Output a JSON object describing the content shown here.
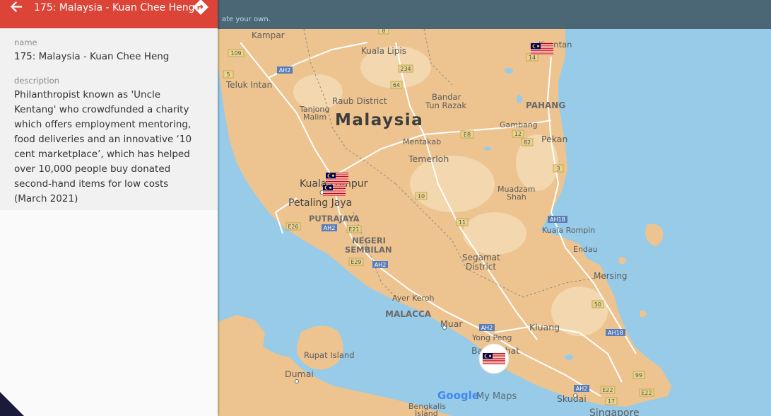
{
  "topbar": {
    "hint_text": "ate your own."
  },
  "panel": {
    "title": "175: Malaysia - Kuan Chee Heng",
    "fields": {
      "name_label": "name",
      "name_value": "175: Malaysia - Kuan Chee Heng",
      "description_label": "description",
      "description_value": "Philanthropist known as 'Uncle Kentang' who crowdfunded a charity which offers employment mentoring, food deliveries and an innovative ‘10 cent marketplace’, which has helped over 10,000 people buy donated second-hand items for low costs (March 2021)"
    }
  },
  "map": {
    "country_label": "Malaysia",
    "attribution": {
      "google": "Google",
      "mymaps": "My Maps"
    },
    "places": {
      "kampar": "Kampar",
      "kuala_lipis": "Kuala Lipis",
      "teluk_intan": "Teluk Intan",
      "raub_district": "Raub District",
      "bandar": "Bandar",
      "tun_razak": "Tun Razak",
      "tanjong": "Tanjong",
      "malim": "Malim",
      "pahang": "PAHANG",
      "kuantan": "Kuantan",
      "gambang": "Gambang",
      "pekan": "Pekan",
      "mentakab": "Mentakab",
      "temerloh": "Temerloh",
      "kuala_lumpur": "Kuala Lumpur",
      "petaling_jaya": "Petaling Jaya",
      "putrajaya": "PUTRAJAYA",
      "negeri": "NEGERI",
      "sembilan": "SEMBILAN",
      "muadzam": "Muadzam",
      "shah": "Shah",
      "kuala_rompin": "Kuala Rompin",
      "endau": "Endau",
      "segamat": "Segamat",
      "district": "District",
      "mersing": "Mersing",
      "ayer_keroh": "Ayer Keroh",
      "malacca": "MALACCA",
      "muar": "Muar",
      "kluang": "Kluang",
      "yong_peng": "Yong Peng",
      "batu_pahat": "Batu Pahat",
      "rupat_island": "Rupat Island",
      "dumai": "Dumai",
      "bengkalis": "Bengkalis",
      "island": "Island",
      "skudai": "Skudai",
      "singapore": "Singapore"
    },
    "road_shields": {
      "r109": "109",
      "r8": "8",
      "r5": "5",
      "ah2a": "AH2",
      "r234": "234",
      "r64": "64",
      "e8": "E8",
      "r12": "12",
      "r82": "82",
      "r14": "14",
      "r3": "3",
      "r10": "10",
      "r11": "11",
      "e26": "E26",
      "ah2b": "AH2",
      "e21": "E21",
      "e29": "E29",
      "ah2c": "AH2",
      "ah18a": "AH18",
      "ah2d": "AH2",
      "r50": "50",
      "ah18b": "AH18",
      "r99": "99",
      "ah2e": "AH2",
      "e22a": "E22",
      "e22b": "E22",
      "r17": "17"
    }
  }
}
